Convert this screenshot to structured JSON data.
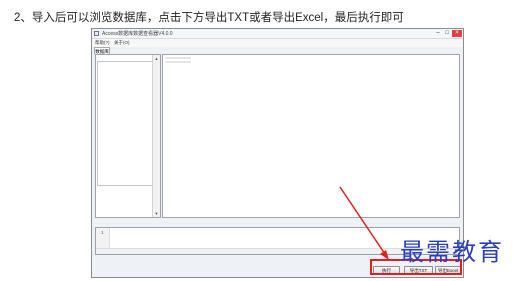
{
  "caption": "2、导入后可以浏览数据库，点击下方导出TXT或者导出Excel，最后执行即可",
  "window": {
    "title": "Access数据库数据查看器V4.0.0",
    "controls": [
      "–",
      "□",
      "×"
    ]
  },
  "menu": [
    "帮助(?)",
    "关于(O)"
  ],
  "tab": "数据库",
  "sql": {
    "line_number": "1"
  },
  "buttons": {
    "execute": "执行",
    "export_txt": "导出TXT",
    "export_excel": "导出Excel"
  },
  "watermark": "最需教育",
  "colors": {
    "highlight": "#e02020",
    "watermark": "#2a3fb8"
  }
}
